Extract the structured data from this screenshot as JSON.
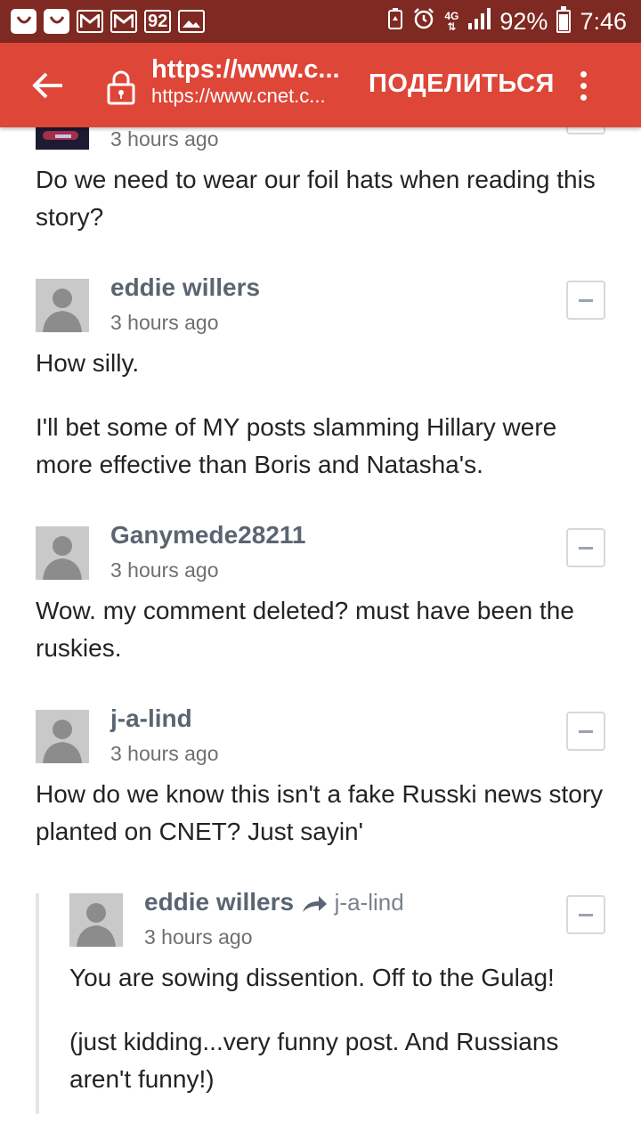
{
  "status_bar": {
    "notification_count": "92",
    "network": "4G",
    "battery_percent": "92%",
    "battery_level": 0.92,
    "time": "7:46"
  },
  "app_bar": {
    "url_title": "https://www.c...",
    "url_sub": "https://www.cnet.c...",
    "share_label": "ПОДЕЛИТЬСЯ"
  },
  "comments": [
    {
      "time": "3 hours ago",
      "body": [
        "Do we need to wear our foil hats when reading this story?"
      ]
    },
    {
      "author": "eddie willers",
      "time": "3 hours ago",
      "body": [
        "How silly.",
        "I'll bet some of MY posts slamming Hillary were more effective than Boris and Natasha's."
      ]
    },
    {
      "author": "Ganymede28211",
      "time": "3 hours ago",
      "body": [
        "Wow. my comment deleted? must have been the ruskies."
      ]
    },
    {
      "author": "j-a-lind",
      "time": "3 hours ago",
      "body": [
        "How do we know this isn't a fake Russki news story planted on CNET? Just sayin'"
      ]
    },
    {
      "author": "eddie willers",
      "reply_to": "j-a-lind",
      "time": "3 hours ago",
      "body": [
        "You are sowing dissention. Off to the Gulag!",
        "(just kidding...very funny post. And Russians aren't funny!)"
      ]
    }
  ],
  "colors": {
    "status_bar_bg": "#7e2922",
    "app_bar_bg": "#de4638",
    "author_text": "#5b6572"
  }
}
